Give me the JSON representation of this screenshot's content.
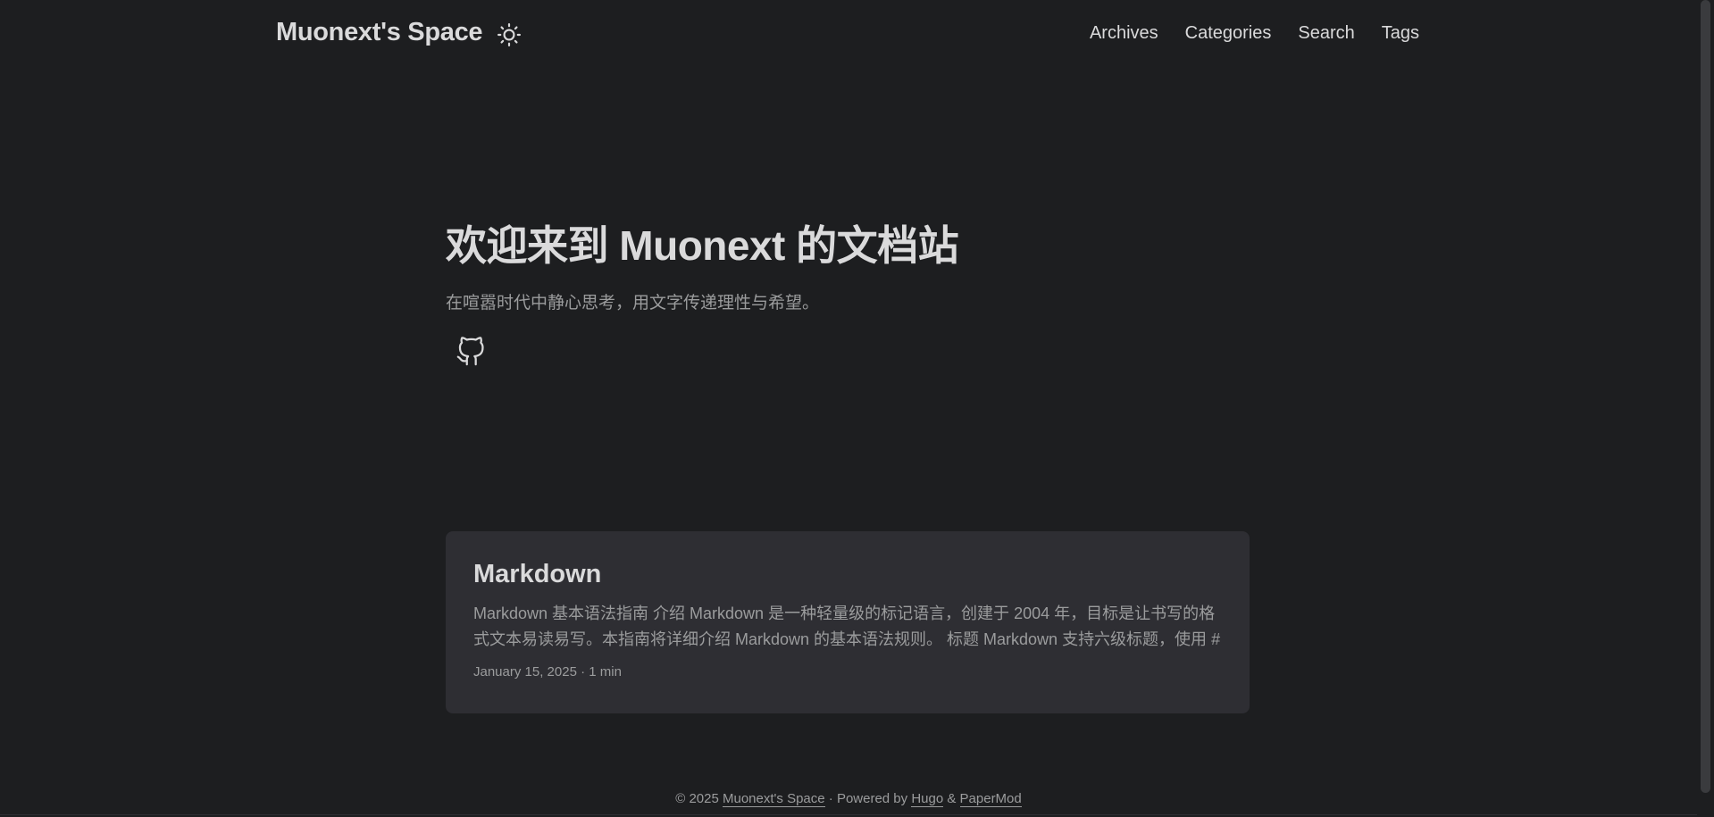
{
  "header": {
    "logo": "Muonext's Space",
    "theme_toggle_icon": "sun-icon",
    "nav": [
      {
        "label": "Archives"
      },
      {
        "label": "Categories"
      },
      {
        "label": "Search"
      },
      {
        "label": "Tags"
      }
    ]
  },
  "hero": {
    "title": "欢迎来到 Muonext 的文档站",
    "subtitle": "在喧嚣时代中静心思考，用文字传递理性与希望。",
    "social_icon": "github-icon"
  },
  "posts": [
    {
      "title": "Markdown",
      "summary": "Markdown 基本语法指南 介绍 Markdown 是一种轻量级的标记语言，创建于 2004 年，目标是让书写的格式文本易读易写。本指南将详细介绍 Markdown 的基本语法规则。 标题 Markdown 支持六级标题，使用 # 符...",
      "meta": "January 15, 2025 · 1 min"
    }
  ],
  "footer": {
    "copyright": "© 2025",
    "site_link": "Muonext's Space",
    "powered_by": " · Powered by",
    "hugo_link": "Hugo",
    "amp": " & ",
    "papermod_link": "PaperMod"
  },
  "colors": {
    "background": "#1d1e20",
    "card": "#2e2e33",
    "text_primary": "#dadadb",
    "text_secondary": "#9b9c9d"
  }
}
